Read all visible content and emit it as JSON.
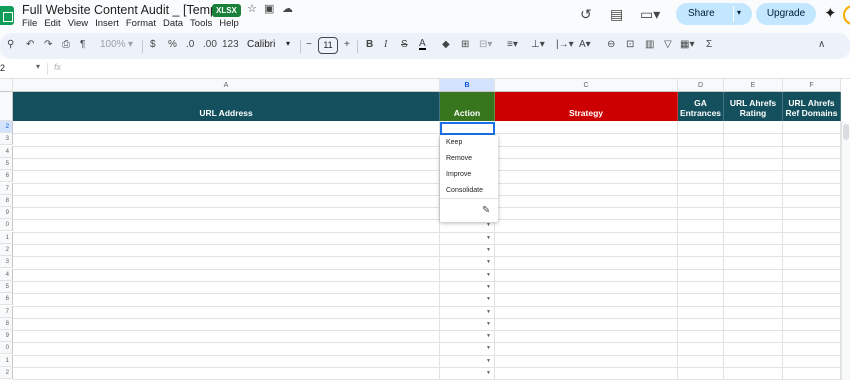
{
  "app": {
    "doc_title": "Full Website Content Audit _ [Template]",
    "file_badge": "XLSX",
    "menu": [
      "File",
      "Edit",
      "View",
      "Insert",
      "Format",
      "Data",
      "Tools",
      "Help"
    ],
    "share_label": "Share",
    "upgrade_label": "Upgrade"
  },
  "toolbar": {
    "zoom": "100%",
    "currency": "$",
    "percent": "%",
    "dec_decrease": ".0",
    "dec_increase": ".00",
    "format_123": "123",
    "font_family": "Calibri",
    "font_size": "11",
    "bold": "B",
    "italic": "I",
    "underline": "A",
    "sigma": "Σ"
  },
  "formula_bar": {
    "name_box": "2",
    "fx": "fx"
  },
  "columns": [
    "A",
    "B",
    "C",
    "D",
    "E",
    "F"
  ],
  "header_row": {
    "url_address": "URL Address",
    "action": "Action",
    "strategy": "Strategy",
    "ga_entrances": "GA Entrances",
    "url_ahrefs_rating": "URL Ahrefs Rating",
    "url_ahrefs_ref_domains": "URL Ahrefs Ref Domains"
  },
  "row_numbers": [
    "",
    "2",
    "3",
    "4",
    "5",
    "6",
    "7",
    "8",
    "9",
    "0",
    "1",
    "2",
    "3",
    "4",
    "5",
    "6",
    "7",
    "8",
    "9",
    "0",
    "1",
    "2"
  ],
  "dropdown": {
    "options": [
      "Keep",
      "Remove",
      "Improve",
      "Consolidate"
    ]
  },
  "colors": {
    "header_teal": "#134f5c",
    "action_green": "#38761d",
    "strategy_red": "#cc0000",
    "selection_blue": "#1a73e8"
  }
}
